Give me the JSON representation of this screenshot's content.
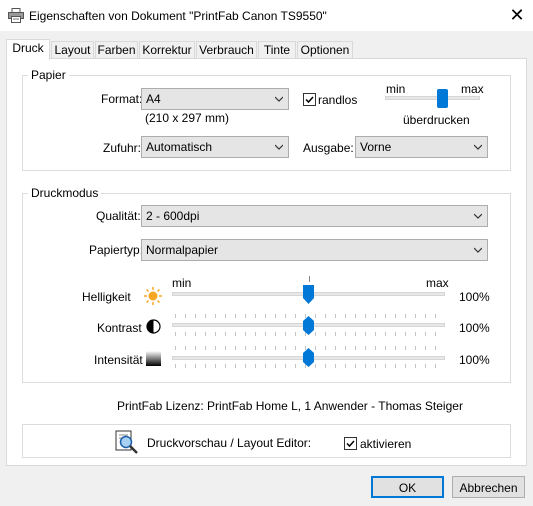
{
  "window": {
    "title": "Eigenschaften von Dokument \"PrintFab Canon TS9550\""
  },
  "tabs": [
    "Druck",
    "Layout",
    "Farben",
    "Korrektur",
    "Verbrauch",
    "Tinte",
    "Optionen"
  ],
  "papier": {
    "legend": "Papier",
    "format_label": "Format:",
    "format_value": "A4",
    "format_size": "(210 x 297 mm)",
    "randlos_label": "randlos",
    "randlos_checked": true,
    "overprint_min": "min",
    "overprint_max": "max",
    "overprint_label": "überdrucken",
    "overprint_level": 0.6,
    "zufuhr_label": "Zufuhr:",
    "zufuhr_value": "Automatisch",
    "ausgabe_label": "Ausgabe:",
    "ausgabe_value": "Vorne"
  },
  "druckmodus": {
    "legend": "Druckmodus",
    "qualitaet_label": "Qualität:",
    "qualitaet_value": "2 - 600dpi",
    "papiertyp_label": "Papiertyp:",
    "papiertyp_value": "Normalpapier",
    "scale_min": "min",
    "scale_max": "max",
    "sliders": [
      {
        "label": "Helligkeit",
        "value": "100%",
        "icon": "sun-icon",
        "level": 0.5
      },
      {
        "label": "Kontrast",
        "value": "100%",
        "icon": "contrast-icon",
        "level": 0.5
      },
      {
        "label": "Intensität",
        "value": "100%",
        "icon": "gradient-icon",
        "level": 0.5
      }
    ]
  },
  "license_text": "PrintFab Lizenz: PrintFab Home L, 1 Anwender - Thomas Steiger",
  "preview": {
    "label": "Druckvorschau / Layout Editor:",
    "aktivieren_label": "aktivieren",
    "aktivieren_checked": true
  },
  "buttons": {
    "ok": "OK",
    "cancel": "Abbrechen"
  },
  "colors": {
    "accent": "#0078d7",
    "sun": "#f5a623"
  }
}
